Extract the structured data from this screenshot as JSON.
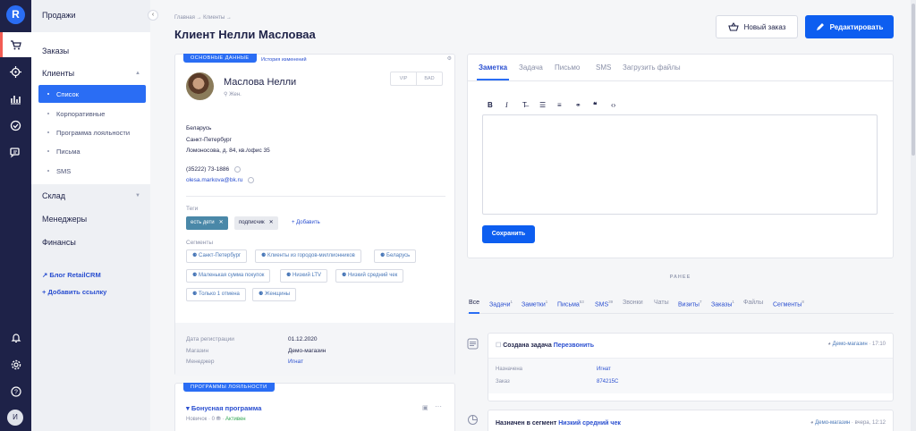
{
  "rail": {
    "logo": "R",
    "avatar": "И"
  },
  "sidebar": {
    "title": "Продажи",
    "items": [
      {
        "label": "Заказы"
      },
      {
        "label": "Клиенты"
      },
      {
        "label": "Склад"
      },
      {
        "label": "Менеджеры"
      },
      {
        "label": "Финансы"
      }
    ],
    "sub_items": [
      {
        "label": "Список"
      },
      {
        "label": "Корпоративные"
      },
      {
        "label": "Программа лояльности"
      },
      {
        "label": "Письма"
      },
      {
        "label": "SMS"
      }
    ],
    "links": [
      {
        "label": "Блог RetailCRM"
      },
      {
        "label": "Добавить ссылку"
      }
    ]
  },
  "header": {
    "breadcrumb": "Главная → Клиенты →",
    "title": "Клиент Нелли Масловаа",
    "new_order": "Новый заказ",
    "edit": "Редактировать"
  },
  "client": {
    "ribbon": "ОСНОВНЫЕ ДАННЫЕ",
    "history": "История изменений",
    "name": "Маслова Нелли",
    "gender": "Жен.",
    "vip": "VIP",
    "bad": "BAD",
    "country": "Беларусь",
    "city": "Санкт-Петербург",
    "address": "Ломоносова, д. 84, кв./офис 35",
    "phone": "(35222) 73-1886",
    "email": "olesa.markova@bk.ru",
    "tags_label": "Теги",
    "tags": [
      "есть дети",
      "подписчик"
    ],
    "add_tag": "Добавить",
    "segments_label": "Сегменты",
    "segments": [
      "Санкт-Петербург",
      "Клиенты из городов-миллионников",
      "Беларусь",
      "Маленькая сумма покупок",
      "Низкий LTV",
      "Низкий средний чек",
      "Только 1 отмена",
      "Женщины"
    ],
    "footer": {
      "reg_label": "Дата регистрации",
      "reg_value": "01.12.2020",
      "shop_label": "Магазин",
      "shop_value": "Демо-магазин",
      "mgr_label": "Менеджер",
      "mgr_value": "Игнат"
    }
  },
  "loyalty": {
    "ribbon": "ПРОГРАММЫ ЛОЯЛЬНОСТИ",
    "program": "Бонусная программа",
    "level": "Новичок",
    "points": "0",
    "status": "Активен"
  },
  "note": {
    "tabs": [
      "Заметка",
      "Задача",
      "Письмо",
      "SMS",
      "Загрузить файлы"
    ],
    "save": "Сохранить"
  },
  "feed": {
    "earlier": "РАНЕЕ",
    "filters": [
      {
        "label": "Все",
        "count": ""
      },
      {
        "label": "Задачи",
        "count": "1"
      },
      {
        "label": "Заметки",
        "count": "1"
      },
      {
        "label": "Письма",
        "count": "53"
      },
      {
        "label": "SMS",
        "count": "39"
      },
      {
        "label": "Звонки",
        "count": ""
      },
      {
        "label": "Чаты",
        "count": ""
      },
      {
        "label": "Визиты",
        "count": "7"
      },
      {
        "label": "Заказы",
        "count": "1"
      },
      {
        "label": "Файлы",
        "count": ""
      },
      {
        "label": "Сегменты",
        "count": "8"
      }
    ],
    "events": [
      {
        "prefix": "Создана задача",
        "link": "Перезвонить",
        "shop": "Демо-магазин",
        "time": "· 17:10",
        "rows": [
          {
            "k": "Назначена",
            "v": "Игнат"
          },
          {
            "k": "Заказ",
            "v": "874215C"
          }
        ]
      },
      {
        "prefix": "Назначен в сегмент",
        "link": "Низкий средний чек",
        "shop": "Демо-магазин",
        "time": "· вчера, 12:12"
      }
    ]
  }
}
